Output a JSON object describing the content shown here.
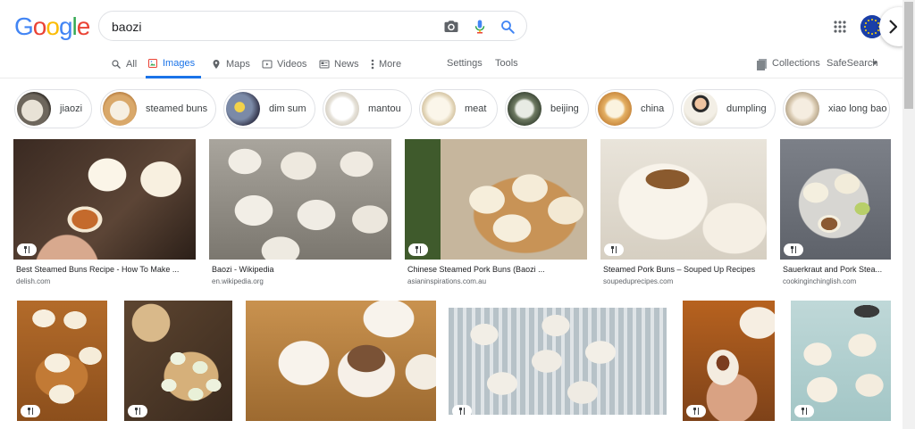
{
  "logo": {
    "letters": [
      "G",
      "o",
      "o",
      "g",
      "l",
      "e"
    ],
    "colors": [
      "#4285f4",
      "#ea4335",
      "#fbbc05",
      "#4285f4",
      "#34a853",
      "#ea4335"
    ]
  },
  "search": {
    "query": "baozi"
  },
  "tabs": [
    {
      "label": "All",
      "icon": "search-icon"
    },
    {
      "label": "Images",
      "icon": "images-icon"
    },
    {
      "label": "Maps",
      "icon": "map-pin-icon"
    },
    {
      "label": "Videos",
      "icon": "play-icon"
    },
    {
      "label": "News",
      "icon": "news-icon"
    },
    {
      "label": "More",
      "icon": "more-vert-icon"
    }
  ],
  "tools": {
    "settings": "Settings",
    "tools": "Tools",
    "collections": "Collections",
    "safesearch": "SafeSearch"
  },
  "chips": [
    {
      "label": "jiaozi"
    },
    {
      "label": "steamed buns"
    },
    {
      "label": "dim sum"
    },
    {
      "label": "mantou"
    },
    {
      "label": "meat"
    },
    {
      "label": "beijing"
    },
    {
      "label": "china"
    },
    {
      "label": "dumpling"
    },
    {
      "label": "xiao long bao"
    }
  ],
  "results_row1": [
    {
      "title": "Best Steamed Buns Recipe - How To Make ...",
      "source": "delish.com"
    },
    {
      "title": "Baozi - Wikipedia",
      "source": "en.wikipedia.org"
    },
    {
      "title": "Chinese Steamed Pork Buns (Baozi ...",
      "source": "asianinspirations.com.au"
    },
    {
      "title": "Steamed Pork Buns – Souped Up Recipes",
      "source": "soupeduprecipes.com"
    },
    {
      "title": "Sauerkraut and Pork Stea...",
      "source": "cookinginchinglish.com"
    }
  ],
  "colors": {
    "accent": "#1a73e8",
    "border": "#dfe1e5",
    "text_secondary": "#5f6368"
  }
}
